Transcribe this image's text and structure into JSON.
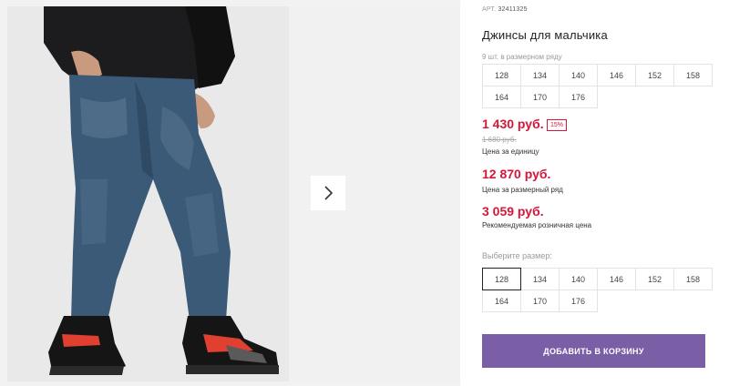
{
  "product": {
    "article_prefix": "АРТ.",
    "article_number": "32411325",
    "title": "Джинсы для мальчика",
    "row_caption": "9 шт. в размерном ряду",
    "row_sizes": [
      "128",
      "134",
      "140",
      "146",
      "152",
      "158",
      "164",
      "170",
      "176"
    ]
  },
  "pricing": {
    "unit_price": "1 430 руб.",
    "discount": "15%",
    "old_price": "1 680 руб.",
    "unit_label": "Цена за единицу",
    "row_price": "12 870 руб.",
    "row_label": "Цена за размерный ряд",
    "rrp_price": "3 059 руб.",
    "rrp_label": "Рекомендуемая розничная цена"
  },
  "size_selector": {
    "label": "Выберите размер:",
    "sizes": [
      "128",
      "134",
      "140",
      "146",
      "152",
      "158",
      "164",
      "170",
      "176"
    ],
    "selected": "128"
  },
  "cart": {
    "add_label": "ДОБАВИТЬ В КОРЗИНУ"
  },
  "gallery": {
    "next_icon": "chevron-right-icon"
  },
  "colors": {
    "price_red": "#d6163a",
    "button_purple": "#7b5fa6"
  }
}
